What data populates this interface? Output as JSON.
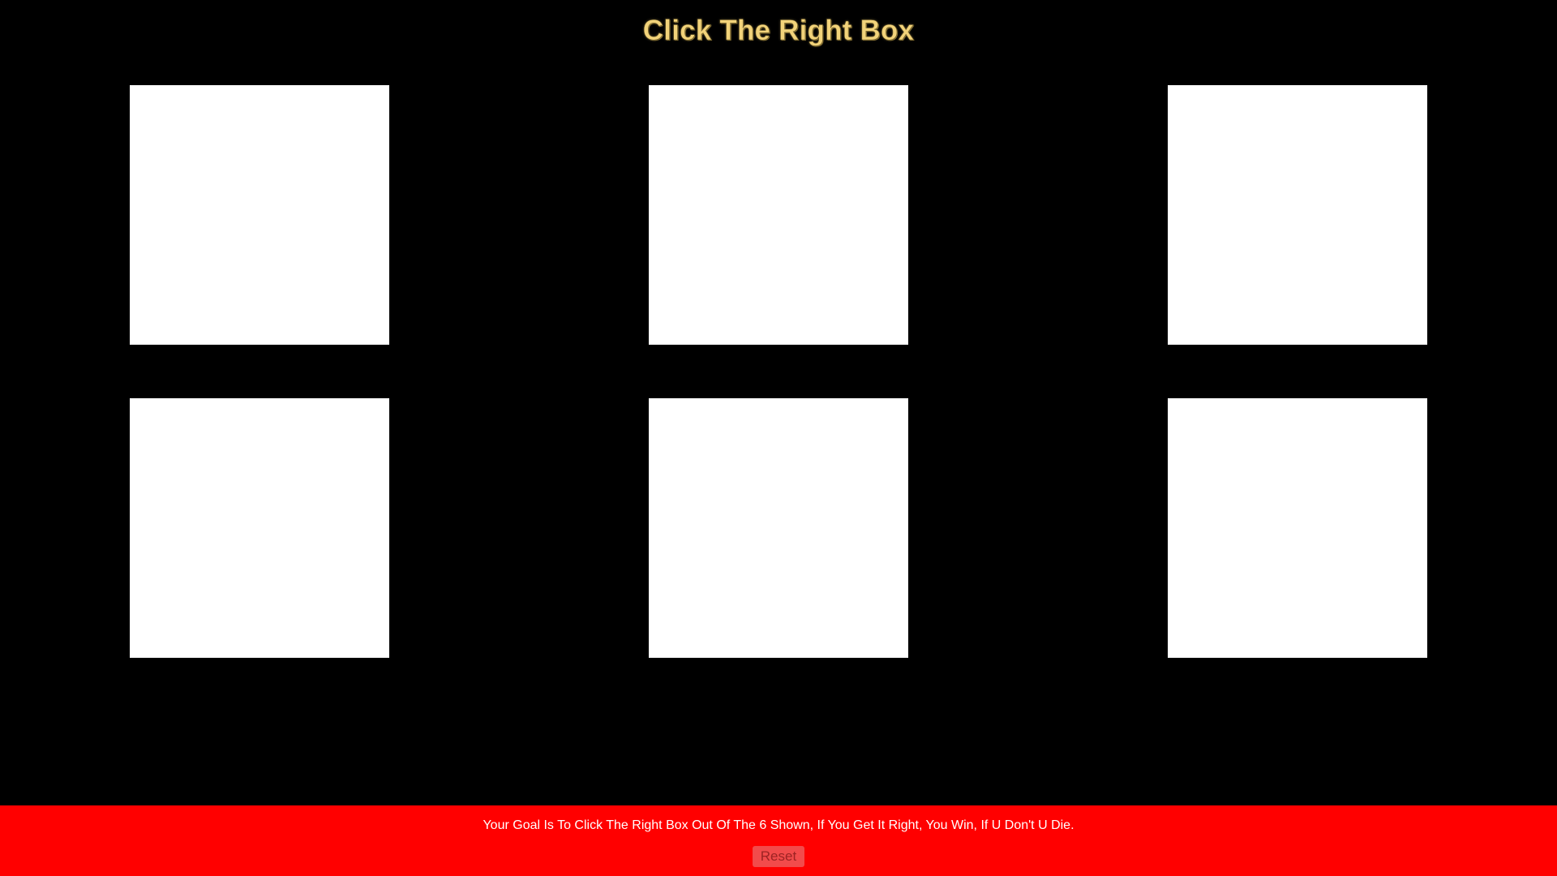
{
  "game": {
    "title": "Click The Right Box",
    "box_count": 6
  },
  "footer": {
    "instructions": "Your Goal Is To Click The Right Box Out Of The 6 Shown, If You Get It Right, You Win, If U Don't U Die.",
    "reset_label": "Reset"
  },
  "colors": {
    "background": "#000000",
    "title": "#f2d37a",
    "box": "#ffffff",
    "footer": "#ff0000",
    "reset_button": "#f24b4b",
    "reset_text": "#9c2323"
  }
}
